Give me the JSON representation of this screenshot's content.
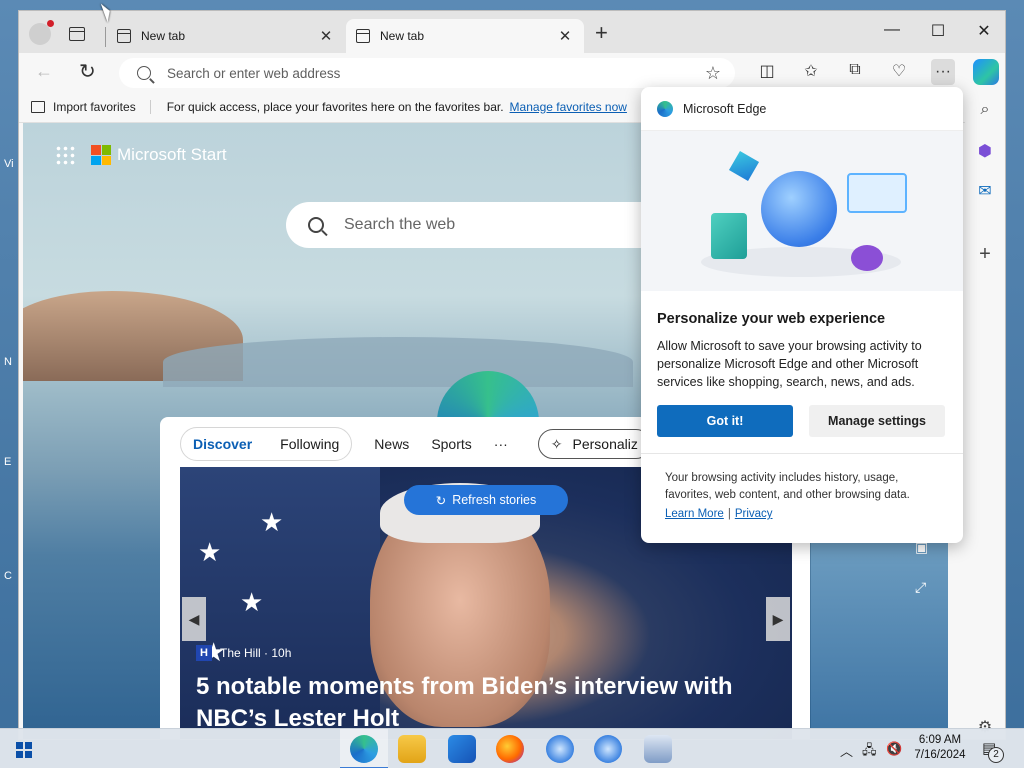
{
  "window": {
    "tabs": [
      {
        "label": "New tab",
        "close": "✕"
      },
      {
        "label": "New tab",
        "close": "✕"
      }
    ],
    "new_tab_icon": "+",
    "controls": {
      "minimize": "—",
      "maximize": "☐",
      "close": "✕"
    }
  },
  "toolbar": {
    "address_placeholder": "Search or enter web address",
    "favorite_star": "☆",
    "icons": [
      "split-screen-icon",
      "favorites-icon",
      "collections-icon",
      "browser-essentials-icon",
      "more-icon",
      "copilot-icon"
    ]
  },
  "favorites_bar": {
    "import_label": "Import favorites",
    "message": "For quick access, place your favorites here on the favorites bar.",
    "manage_link": "Manage favorites now"
  },
  "start_page": {
    "brand": "Microsoft Start",
    "search_placeholder": "Search the web",
    "feed_tabs": {
      "discover": "Discover",
      "following": "Following",
      "news": "News",
      "sports": "Sports",
      "more": "···",
      "personalize": "Personaliz"
    },
    "refresh_label": "Refresh stories",
    "story": {
      "source_badge": "H",
      "source": "The Hill · 10h",
      "headline": "5 notable moments from Biden’s interview with NBC’s Lester Holt"
    }
  },
  "popup": {
    "app_name": "Microsoft Edge",
    "title": "Personalize your web experience",
    "body": "Allow Microsoft to save your browsing activity to personalize Microsoft Edge and other Microsoft services like shopping, search, news, and ads.",
    "primary_button": "Got it!",
    "secondary_button": "Manage settings",
    "footer": "Your browsing activity includes history, usage, favorites, web content, and other browsing data.",
    "learn_more": "Learn More",
    "separator": "|",
    "privacy": "Privacy"
  },
  "taskbar": {
    "time": "6:09 AM",
    "date": "7/16/2024",
    "notification_count": "2"
  },
  "desktop_letters": [
    "Vi",
    "N",
    "E",
    "C"
  ],
  "colors": {
    "accent": "#0f6cbd",
    "link": "#0b5fb4",
    "refresh_button": "#2574d8"
  }
}
